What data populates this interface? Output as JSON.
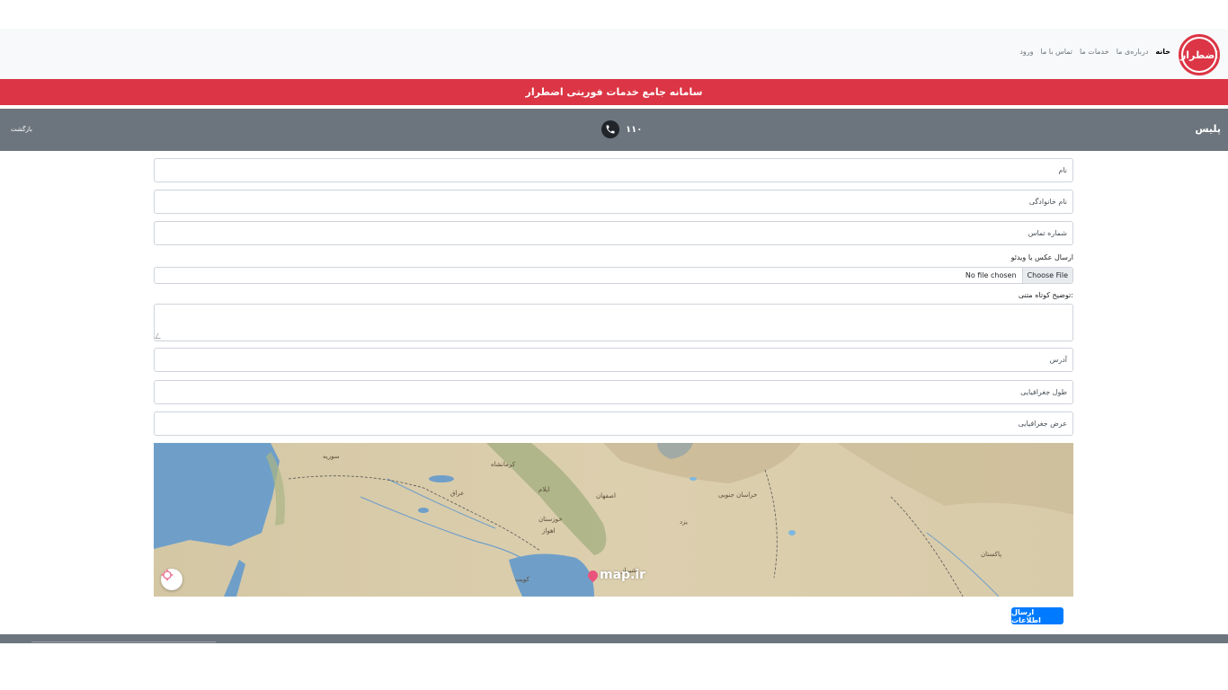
{
  "navbar": {
    "logo_text": "اضطرار",
    "links": [
      {
        "label": "خانه",
        "active": true
      },
      {
        "label": "درباره‌ی ما",
        "active": false
      },
      {
        "label": "خدمات ما",
        "active": false
      },
      {
        "label": "تماس با ما",
        "active": false
      },
      {
        "label": "ورود",
        "active": false
      }
    ]
  },
  "banner": {
    "title": "سامانه جامع خدمات فوریتی اضطرار"
  },
  "service": {
    "name": "پلیس",
    "phone": "۱۱۰",
    "back_label": "بازگشت",
    "phone_icon": "phone-icon"
  },
  "form": {
    "first_name_placeholder": "نام",
    "last_name_placeholder": "نام خانوادگی",
    "phone_placeholder": "شماره تماس",
    "media_label": "ارسال عکس یا ویدئو",
    "file_button": "Choose File",
    "file_status": "No file chosen",
    "description_label": "توضیح کوتاه متنی:",
    "address_placeholder": "آدرس",
    "longitude_placeholder": "طول جغرافیایی",
    "latitude_placeholder": "عرض جغرافیایی",
    "submit_label": "ارسال اطلاعات"
  },
  "map": {
    "labels": [
      "سوریه",
      "عراق",
      "کرمانشاه",
      "ایلام",
      "خوزستان",
      "اهواز",
      "اصفهان",
      "خراسان جنوبی",
      "یزد",
      "شیراز",
      "کویت",
      "پاکستان"
    ],
    "brand": "map.ir",
    "locate_icon": "crosshair-icon"
  },
  "colors": {
    "banner": "#dc3545",
    "service_bar": "#6c757d",
    "submit": "#007bff"
  }
}
